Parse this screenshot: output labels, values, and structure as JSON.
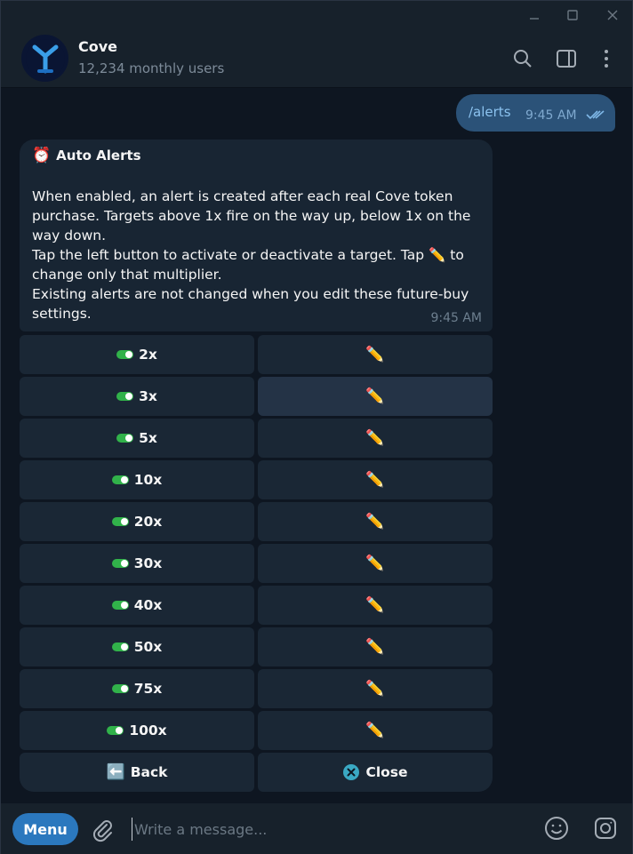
{
  "header": {
    "title": "Cove",
    "subtitle": "12,234 monthly users"
  },
  "outgoing": {
    "text": "/alerts",
    "time": "9:45 AM"
  },
  "incoming": {
    "title": "Auto Alerts",
    "lines": [
      "When enabled, an alert is created after each real Cove token purchase. Targets above 1x fire on the way up, below 1x on the way down.",
      "Tap the left button to activate or deactivate a target. Tap ✏️ to change only that multiplier.",
      "Existing alerts are not changed when you edit these future-buy settings."
    ],
    "time": "9:45 AM"
  },
  "keyboard": {
    "targets": [
      {
        "label": "2x",
        "active": true
      },
      {
        "label": "3x",
        "active": true
      },
      {
        "label": "5x",
        "active": true
      },
      {
        "label": "10x",
        "active": true
      },
      {
        "label": "20x",
        "active": true
      },
      {
        "label": "30x",
        "active": true
      },
      {
        "label": "40x",
        "active": true
      },
      {
        "label": "50x",
        "active": true
      },
      {
        "label": "75x",
        "active": true
      },
      {
        "label": "100x",
        "active": true
      }
    ],
    "edit_glyph": "✏️",
    "back_glyph": "⬅️",
    "back_label": "Back",
    "close_label": "Close"
  },
  "composer": {
    "menu_label": "Menu",
    "placeholder": "Write a message..."
  },
  "colors": {
    "accent": "#2b78be",
    "outgoing_bubble": "#2b5278",
    "incoming_bubble": "#182533",
    "toggle_on": "#31b24a"
  },
  "icons": [
    "minimize-icon",
    "maximize-icon",
    "close-icon",
    "search-icon",
    "sidebar-toggle-icon",
    "more-vertical-icon",
    "paperclip-icon",
    "emoji-icon",
    "instagram-icon",
    "alarm-clock-icon",
    "pencil-icon",
    "back-arrow-icon",
    "close-circle-icon",
    "double-check-icon"
  ]
}
